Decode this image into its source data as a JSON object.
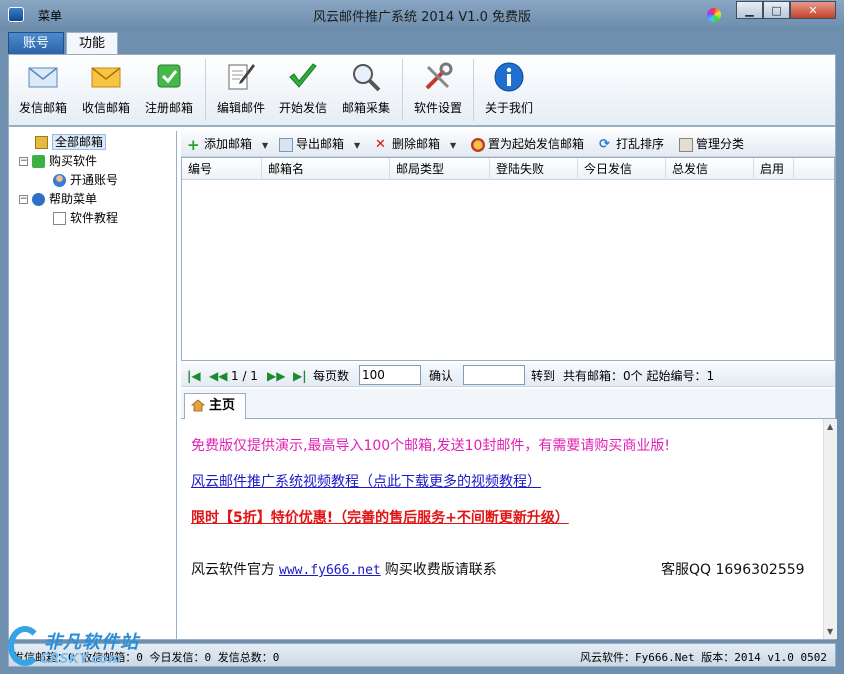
{
  "window": {
    "menu_label": "菜单",
    "title": "风云邮件推广系统 2014 V1.0 免费版",
    "minimize": "▁",
    "maximize": "□",
    "close": "✕"
  },
  "tabs": [
    {
      "label": "账号"
    },
    {
      "label": "功能"
    }
  ],
  "ribbon": [
    {
      "label": "发信邮箱",
      "icon": "envelope-icon"
    },
    {
      "label": "收信邮箱",
      "icon": "yellow-envelope-icon"
    },
    {
      "label": "注册邮箱",
      "icon": "checkmark-box-icon"
    },
    {
      "label": "编辑邮件",
      "icon": "edit-pen-icon"
    },
    {
      "label": "开始发信",
      "icon": "green-check-icon"
    },
    {
      "label": "邮箱采集",
      "icon": "magnifier-icon"
    },
    {
      "label": "软件设置",
      "icon": "tools-icon"
    },
    {
      "label": "关于我们",
      "icon": "info-icon"
    }
  ],
  "tree": {
    "all_mailboxes": "全部邮箱",
    "buy_software": "购买软件",
    "open_account": "开通账号",
    "help_menu": "帮助菜单",
    "tutorial": "软件教程"
  },
  "toolbar": {
    "add": "添加邮箱",
    "export": "导出邮箱",
    "delete": "删除邮箱",
    "set_start": "置为起始发信邮箱",
    "shuffle": "打乱排序",
    "manage": "管理分类"
  },
  "grid": {
    "columns": [
      "编号",
      "邮箱名",
      "邮局类型",
      "登陆失败",
      "今日发信",
      "总发信",
      "启用"
    ],
    "rows": []
  },
  "pager": {
    "page_info": "1 / 1",
    "per_page_label": "每页数",
    "per_page_value": "100",
    "confirm_label": "确认",
    "goto_value": "",
    "goto_label": "转到",
    "summary": "共有邮箱：0个 起始编号：1"
  },
  "home_tab": {
    "label": "主页"
  },
  "content": {
    "notice": "免费版仅提供演示,最高导入100个邮箱,发送10封邮件，有需要请购买商业版!",
    "video_link": "风云邮件推广系统视频教程（点此下载更多的视频教程）",
    "promo": "限时【5折】特价优惠!（完善的售后服务+不间断更新升级）",
    "official_label": "风云软件官方",
    "official_url": "www.fy666.net",
    "buy_label": "购买收费版请联系",
    "qq": "客服QQ 1696302559"
  },
  "status": {
    "left": "发信邮箱：0 收信邮箱：0 今日发信：0 发信总数：0",
    "right": "风云软件：Fy666.Net 版本：2014 v1.0 0502"
  },
  "watermark": {
    "text": "非凡软件站",
    "sub": "CRSKY.com"
  }
}
